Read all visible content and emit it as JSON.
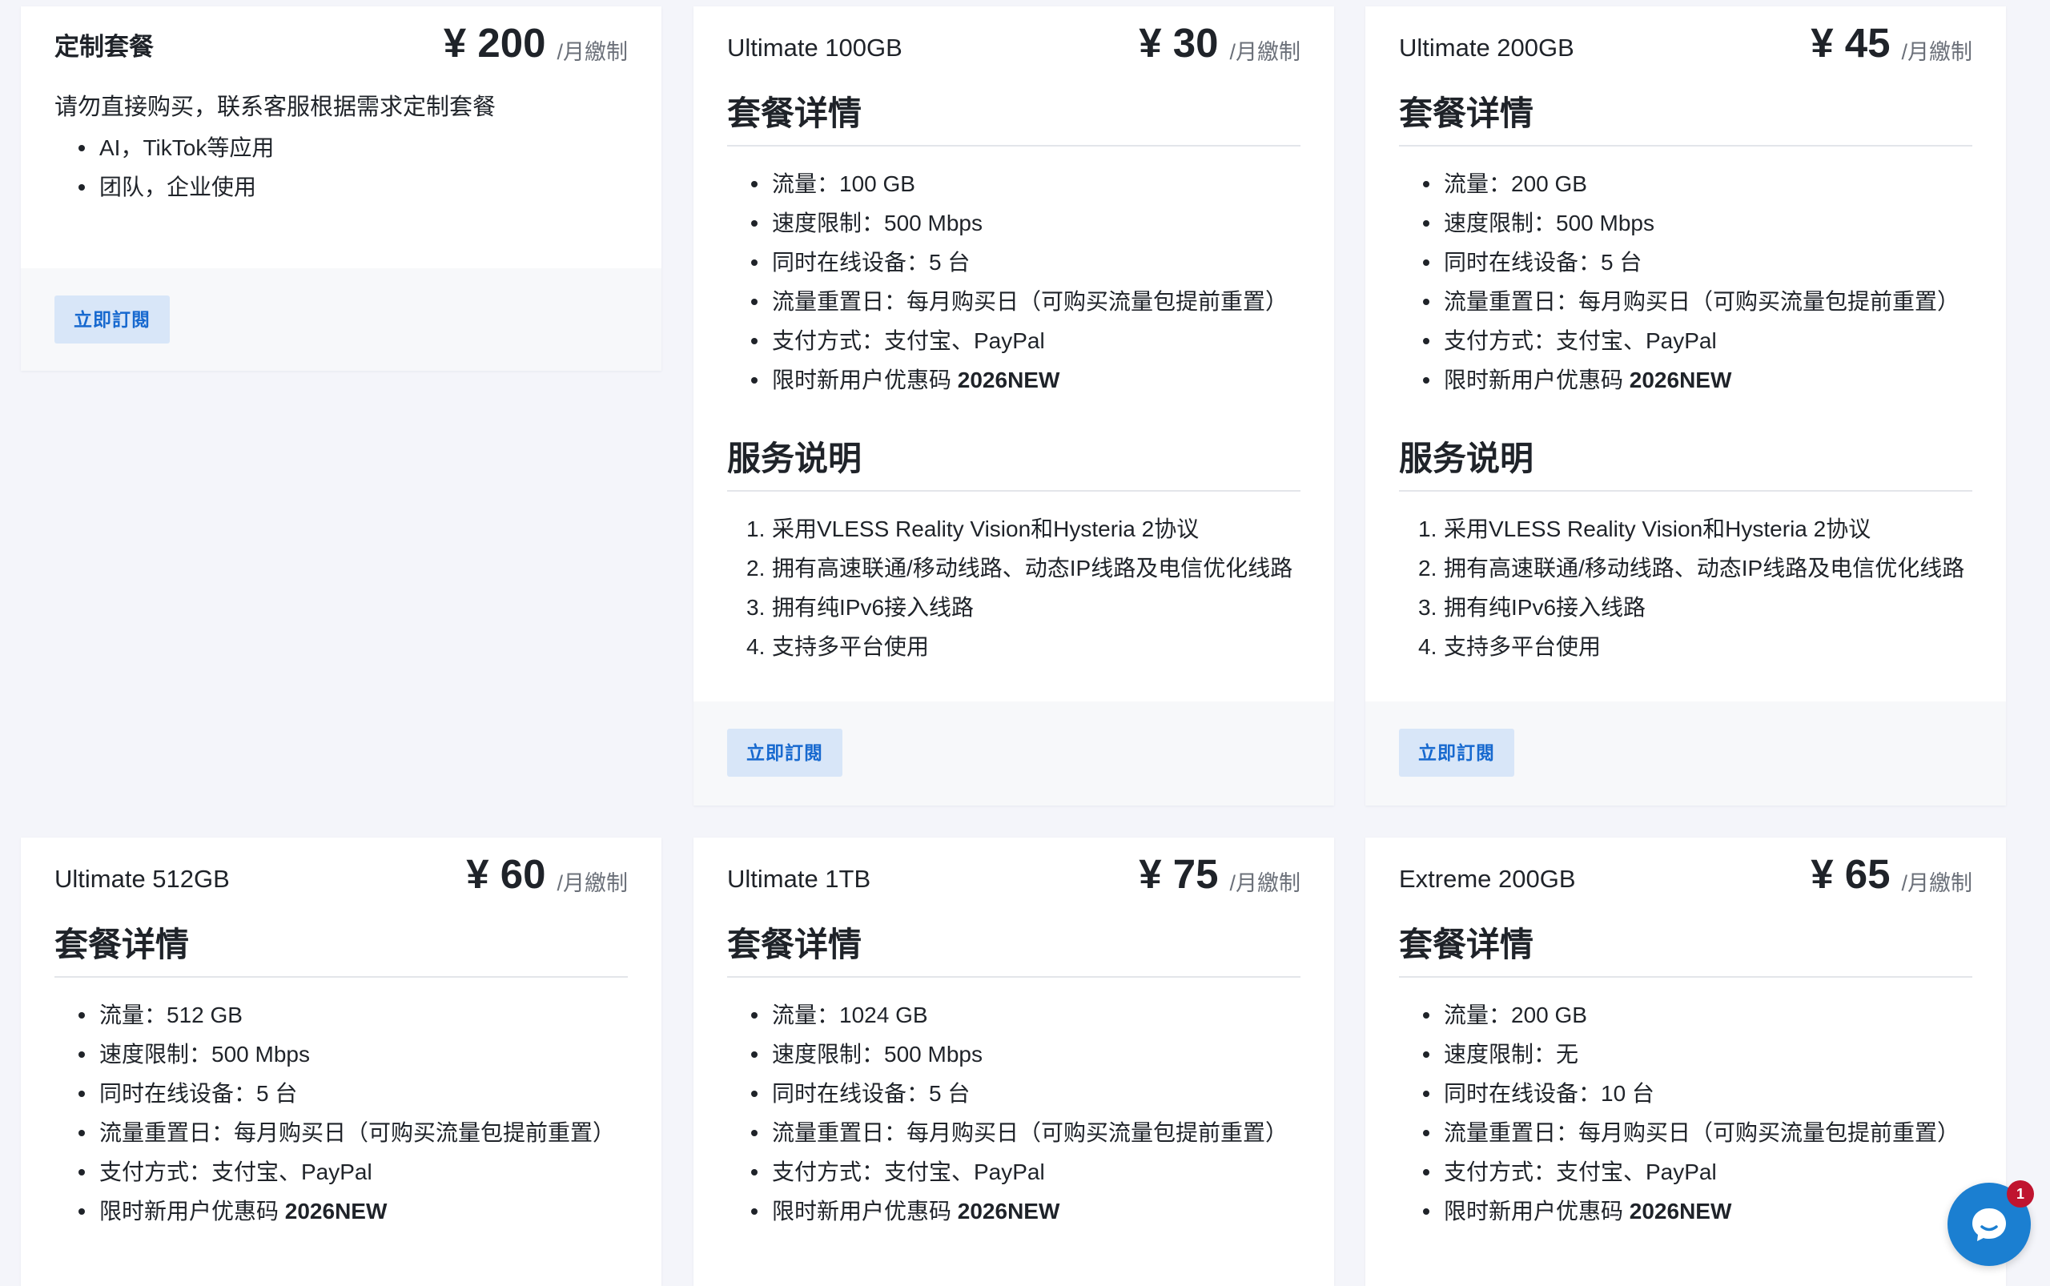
{
  "plans": [
    {
      "name": "定制套餐",
      "price": "¥ 200",
      "unit": "/月繳制",
      "desc": "请勿直接购买，联系客服根据需求定制套餐",
      "features": [
        "AI，TikTok等应用",
        "团队，企业使用"
      ],
      "button": "立即訂閱"
    },
    {
      "name": "Ultimate 100GB",
      "price": "¥ 30",
      "unit": "/月繳制",
      "details_title": "套餐详情",
      "details": [
        "流量：100 GB",
        "速度限制：500 Mbps",
        "同时在线设备：5 台",
        "流量重置日：每月购买日（可购买流量包提前重置）",
        "支付方式：支付宝、PayPal"
      ],
      "promo_prefix": "限时新用户优惠码 ",
      "promo_code": "2026NEW",
      "service_title": "服务说明",
      "services": [
        "采用VLESS Reality Vision和Hysteria 2协议",
        "拥有高速联通/移动线路、动态IP线路及电信优化线路",
        "拥有纯IPv6接入线路",
        "支持多平台使用"
      ],
      "button": "立即訂閱"
    },
    {
      "name": "Ultimate 200GB",
      "price": "¥ 45",
      "unit": "/月繳制",
      "details_title": "套餐详情",
      "details": [
        "流量：200 GB",
        "速度限制：500 Mbps",
        "同时在线设备：5 台",
        "流量重置日：每月购买日（可购买流量包提前重置）",
        "支付方式：支付宝、PayPal"
      ],
      "promo_prefix": "限时新用户优惠码 ",
      "promo_code": "2026NEW",
      "service_title": "服务说明",
      "services": [
        "采用VLESS Reality Vision和Hysteria 2协议",
        "拥有高速联通/移动线路、动态IP线路及电信优化线路",
        "拥有纯IPv6接入线路",
        "支持多平台使用"
      ],
      "button": "立即訂閱"
    },
    {
      "name": "Ultimate 512GB",
      "price": "¥ 60",
      "unit": "/月繳制",
      "details_title": "套餐详情",
      "details": [
        "流量：512 GB",
        "速度限制：500 Mbps",
        "同时在线设备：5 台",
        "流量重置日：每月购买日（可购买流量包提前重置）",
        "支付方式：支付宝、PayPal"
      ],
      "promo_prefix": "限时新用户优惠码 ",
      "promo_code": "2026NEW"
    },
    {
      "name": "Ultimate 1TB",
      "price": "¥ 75",
      "unit": "/月繳制",
      "details_title": "套餐详情",
      "details": [
        "流量：1024 GB",
        "速度限制：500 Mbps",
        "同时在线设备：5 台",
        "流量重置日：每月购买日（可购买流量包提前重置）",
        "支付方式：支付宝、PayPal"
      ],
      "promo_prefix": "限时新用户优惠码 ",
      "promo_code": "2026NEW"
    },
    {
      "name": "Extreme 200GB",
      "price": "¥ 65",
      "unit": "/月繳制",
      "details_title": "套餐详情",
      "details": [
        "流量：200 GB",
        "速度限制：无",
        "同时在线设备：10 台",
        "流量重置日：每月购买日（可购买流量包提前重置）",
        "支付方式：支付宝、PayPal"
      ],
      "promo_prefix": "限时新用户优惠码 ",
      "promo_code": "2026NEW"
    }
  ],
  "chat": {
    "icon": "chat-bubble-icon",
    "badge": "1",
    "color": "#1b7fd1",
    "badge_color": "#c0142f"
  },
  "colors": {
    "page_bg": "#f4f5fa",
    "button_bg": "#d8e6f8",
    "button_text": "#1769cf"
  }
}
